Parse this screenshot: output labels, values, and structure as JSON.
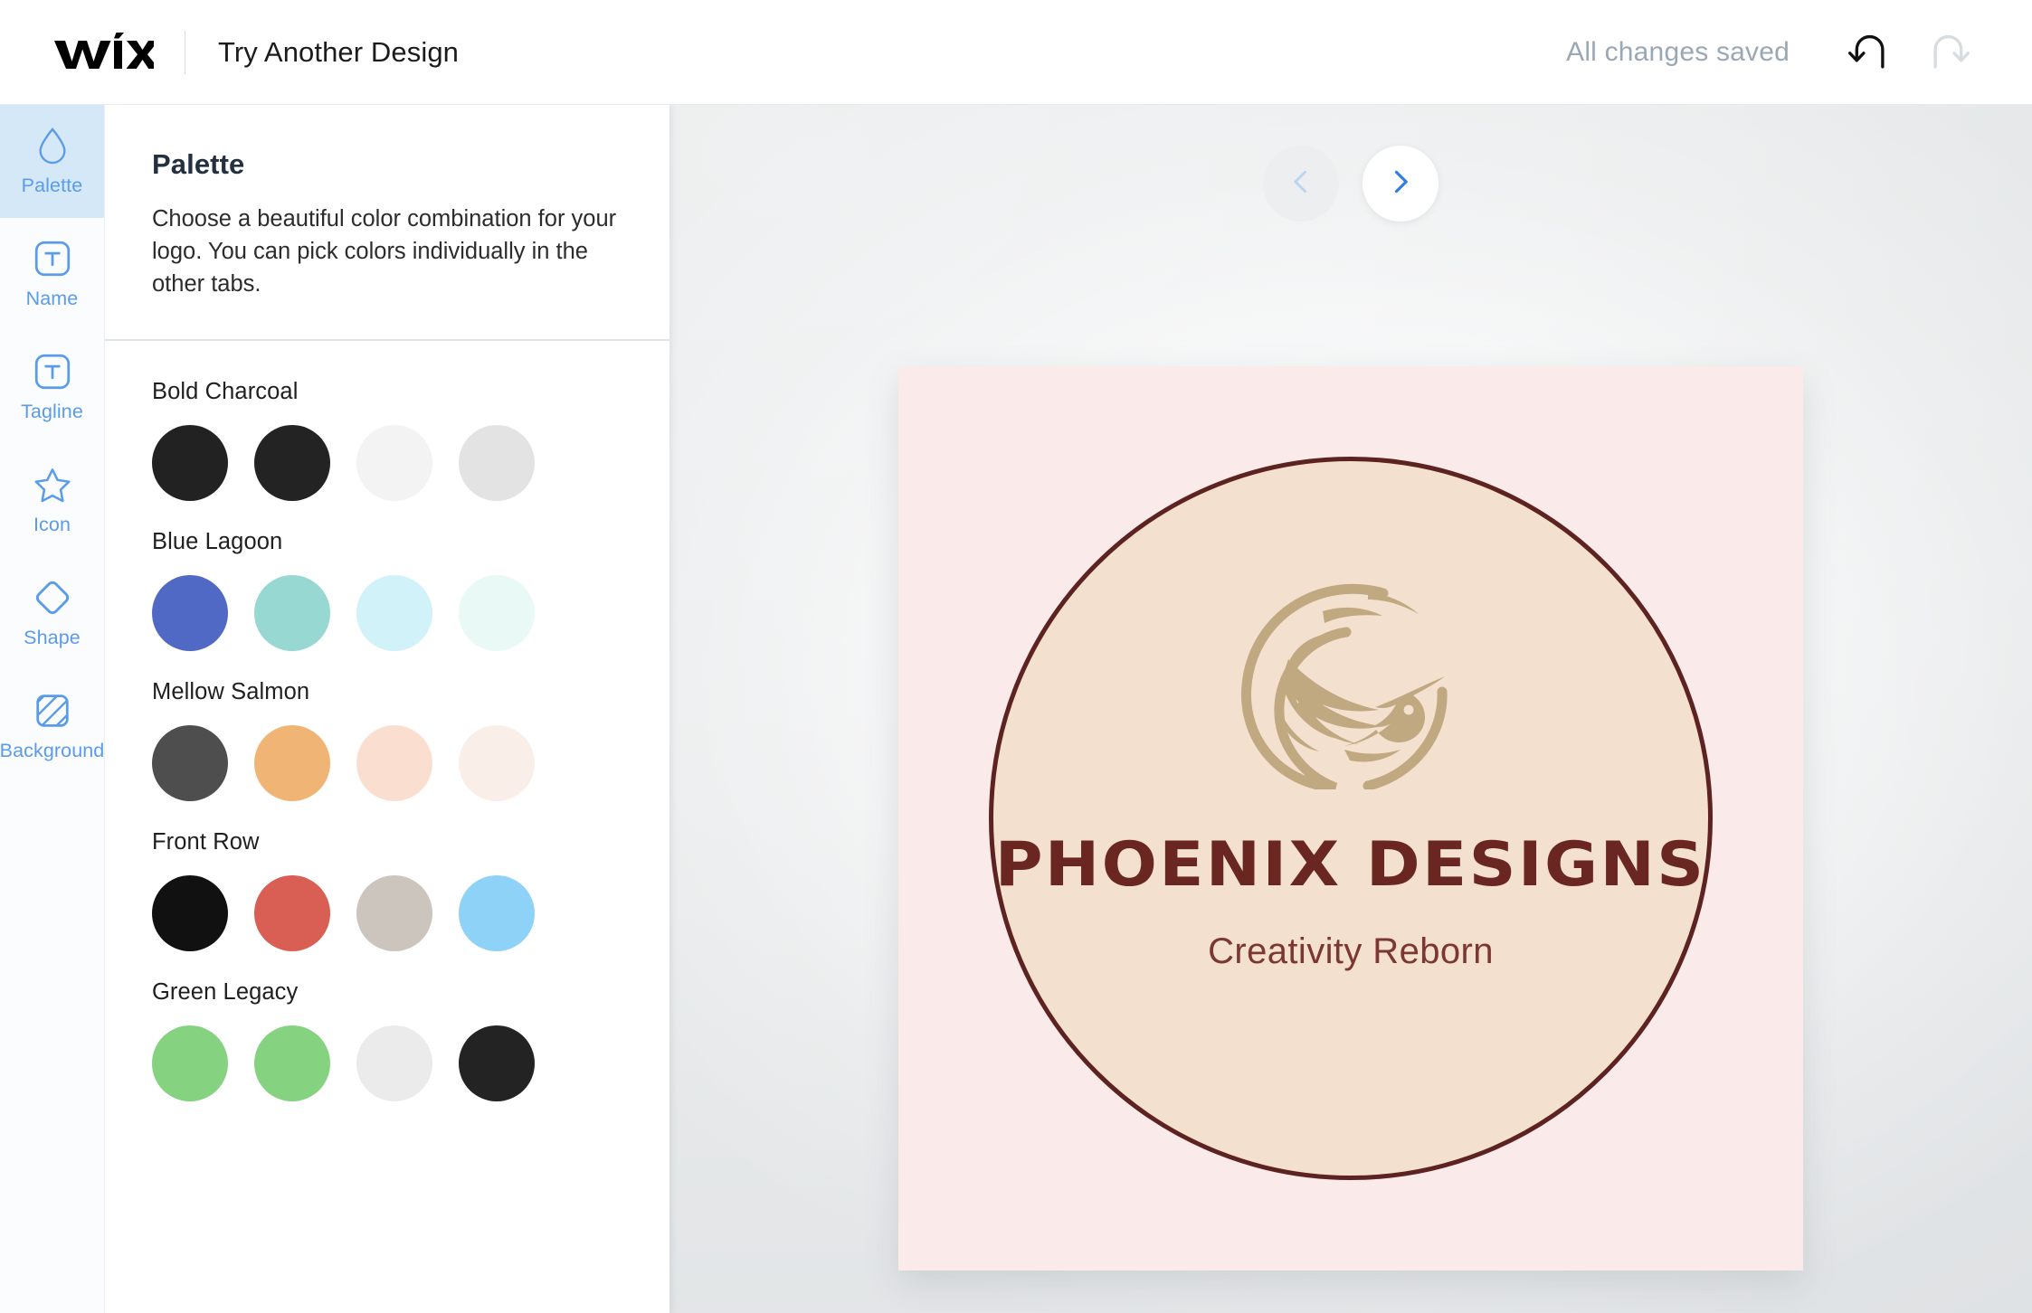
{
  "header": {
    "brand": "WiX",
    "brand_icon": "wix-logo",
    "title": "Try Another Design",
    "save_status": "All changes saved",
    "undo_icon": "undo-arrow-icon",
    "redo_icon": "redo-arrow-icon",
    "undo_enabled": "true",
    "redo_enabled": "false"
  },
  "sidebar": {
    "items": [
      {
        "label": "Palette",
        "icon": "droplet-icon",
        "active": true
      },
      {
        "label": "Name",
        "icon": "text-box-icon",
        "active": false
      },
      {
        "label": "Tagline",
        "icon": "text-box-icon",
        "active": false
      },
      {
        "label": "Icon",
        "icon": "star-icon",
        "active": false
      },
      {
        "label": "Shape",
        "icon": "diamond-icon",
        "active": false
      },
      {
        "label": "Background",
        "icon": "striped-square-icon",
        "active": false
      }
    ]
  },
  "panel": {
    "title": "Palette",
    "description": "Choose a beautiful color combination for your logo. You can pick colors individually in the other tabs.",
    "palettes": [
      {
        "name": "Bold Charcoal",
        "colors": [
          "#222222",
          "#232323",
          "#f3f3f3",
          "#e3e3e3"
        ]
      },
      {
        "name": "Blue Lagoon",
        "colors": [
          "#5069c4",
          "#97d8d3",
          "#d2f2f9",
          "#e9faf6"
        ]
      },
      {
        "name": "Mellow Salmon",
        "colors": [
          "#4e4e4e",
          "#f0b574",
          "#fadfd0",
          "#faeee8"
        ]
      },
      {
        "name": "Front Row",
        "colors": [
          "#111111",
          "#d95f55",
          "#ccc5be",
          "#8ed2f7"
        ]
      },
      {
        "name": "Green Legacy",
        "colors": [
          "#85d381",
          "#85d381",
          "#ebebeb",
          "#232323"
        ]
      }
    ]
  },
  "canvas": {
    "prev_icon": "chevron-left-icon",
    "next_icon": "chevron-right-icon",
    "prev_enabled": "false",
    "next_enabled": "true",
    "logo": {
      "name": "PHOENIX DESIGNS",
      "tagline": "Creativity Reborn",
      "mark_icon": "phoenix-bird-icon",
      "background_color": "#faeaea",
      "circle_color": "#f4e0cf",
      "circle_border_color": "#5d2320",
      "mark_color": "#c0a880",
      "name_color": "#6a2722",
      "tagline_color": "#7b3731"
    }
  }
}
